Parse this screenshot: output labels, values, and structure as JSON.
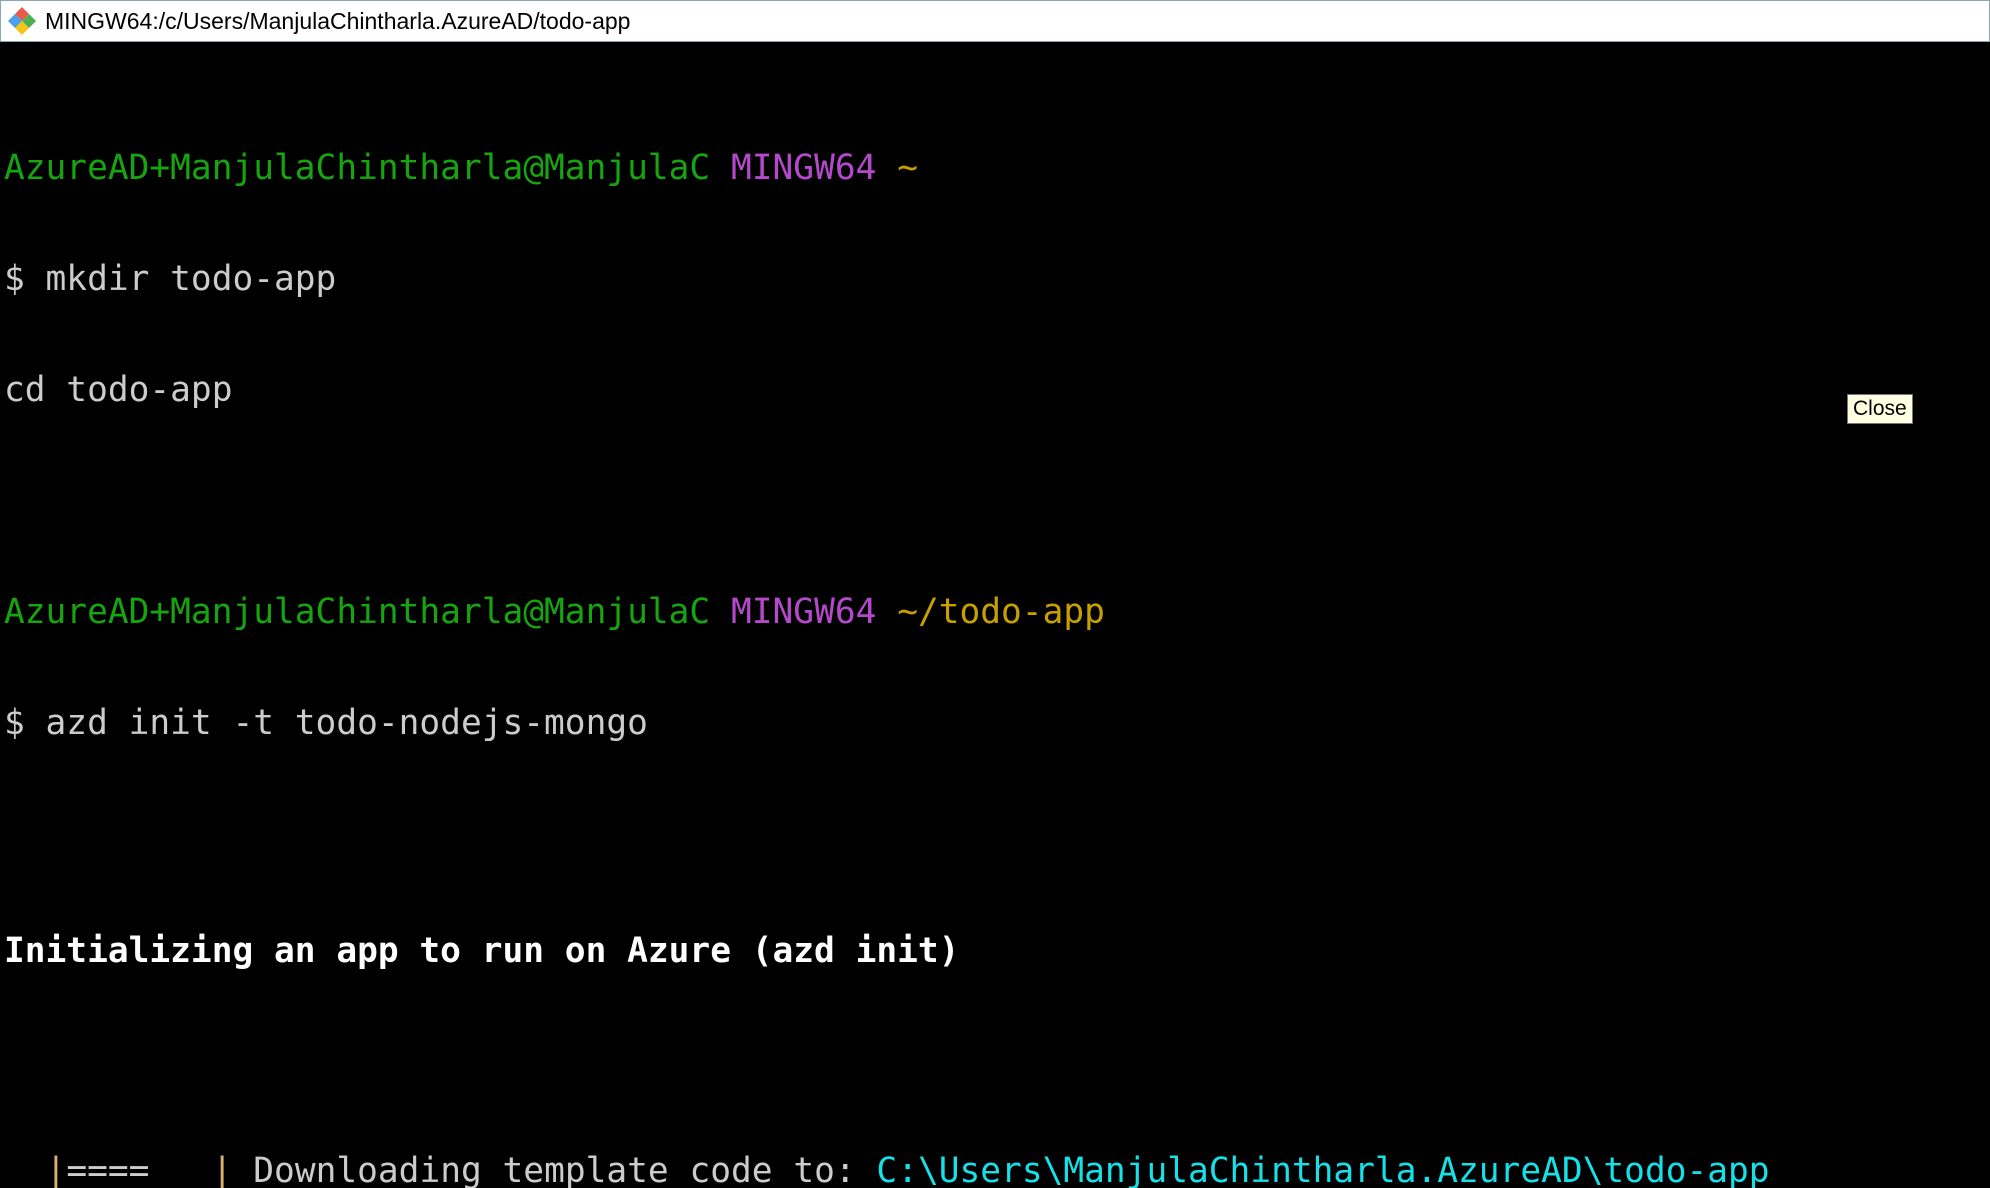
{
  "window": {
    "title": "MINGW64:/c/Users/ManjulaChintharla.AzureAD/todo-app",
    "icon": "git-bash-icon"
  },
  "terminal": {
    "prompt1": {
      "user_host": "AzureAD+ManjulaChintharla@ManjulaC",
      "system": "MINGW64",
      "path": "~"
    },
    "cmd1": "$ mkdir todo-app",
    "cmd1b": "cd todo-app",
    "prompt2": {
      "user_host": "AzureAD+ManjulaChintharla@ManjulaC",
      "system": "MINGW64",
      "path": "~/todo-app"
    },
    "cmd2": "$ azd init -t todo-nodejs-mongo",
    "heading": "Initializing an app to run on Azure (azd init)",
    "progress": {
      "bar_left": "|",
      "fill": "====",
      "bar_right": "|",
      "text": " Downloading template code to: ",
      "path": "C:\\Users\\ManjulaChintharla.AzureAD\\todo-app"
    }
  },
  "tooltip": {
    "label": "Close"
  },
  "colors": {
    "user": "#16a50e",
    "system": "#b549cc",
    "path": "#c7a000",
    "target": "#16e0e8",
    "background": "#000000"
  }
}
